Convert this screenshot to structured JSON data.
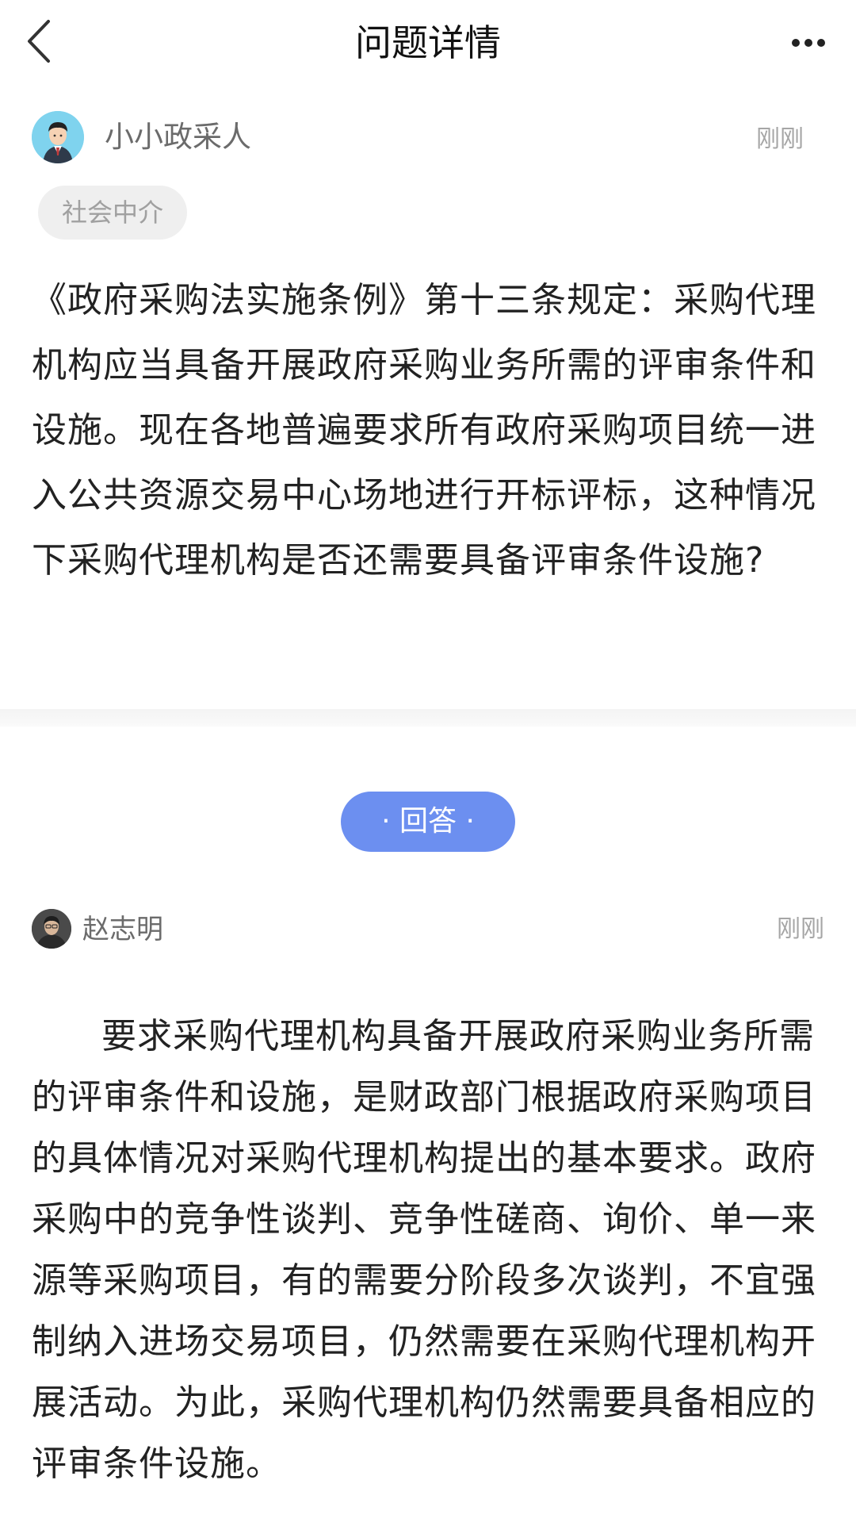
{
  "header": {
    "title": "问题详情",
    "back_icon": "chevron-left-icon",
    "more_icon": "more-dots-icon"
  },
  "question": {
    "author_name": "小小政采人",
    "time": "刚刚",
    "tag": "社会中介",
    "text": "《政府采购法实施条例》第十三条规定：采购代理机构应当具备开展政府采购业务所需的评审条件和设施。现在各地普遍要求所有政府采购项目统一进入公共资源交易中心场地进行开标评标，这种情况下采购代理机构是否还需要具备评审条件设施?"
  },
  "answer_section": {
    "label": "· 回答 ·"
  },
  "answer": {
    "author_name": "赵志明",
    "time": "刚刚",
    "text": "要求采购代理机构具备开展政府采购业务所需的评审条件和设施，是财政部门根据政府采购项目的具体情况对采购代理机构提出的基本要求。政府采购中的竞争性谈判、竞争性磋商、询价、单一来源等采购项目，有的需要分阶段多次谈判，不宜强制纳入进场交易项目，仍然需要在采购代理机构开展活动。为此，采购代理机构仍然需要具备相应的评审条件设施。"
  },
  "colors": {
    "accent": "#6c8ff0",
    "muted_text": "#a6a6a6",
    "tag_bg": "#efefef"
  }
}
